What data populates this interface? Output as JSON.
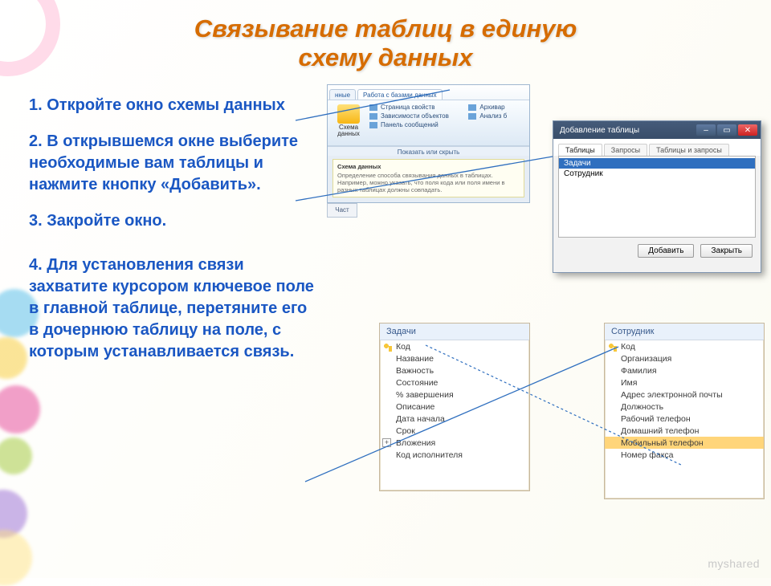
{
  "title_line1": "Связывание таблиц в единую",
  "title_line2": "схему данных",
  "steps": {
    "s1": "1. Откройте окно схемы данных",
    "s2": "2. В открывшемся окне выберите необходимые вам таблицы и нажмите кнопку «Добавить».",
    "s3": "3. Закройте окно.",
    "s4": "4. Для установления связи захватите курсором ключевое поле в главной таблице, перетяните его в дочернюю таблицу на поле, с которым устанавливается связь."
  },
  "ribbon": {
    "tab_data": "нные",
    "tab_work": "Работа с базами данных",
    "btn_schema": "Схема данных",
    "item_props": "Страница свойств",
    "item_deps": "Зависимости объектов",
    "item_msgs": "Панель сообщений",
    "item_arch": "Архивар",
    "item_anal": "Анализ б",
    "group_caption": "Показать или скрыть",
    "tooltip_title": "Схема данных",
    "tooltip_body": "Определение способа связывания данных в таблицах. Например, можно указать, что поля кода или поля имени в разных таблицах должны совпадать.",
    "side_chunk": "Част"
  },
  "dialog": {
    "title": "Добавление таблицы",
    "tab_tables": "Таблицы",
    "tab_queries": "Запросы",
    "tab_both": "Таблицы и запросы",
    "list_item1": "Задачи",
    "list_item2": "Сотрудник",
    "btn_add": "Добавить",
    "btn_close": "Закрыть"
  },
  "fieldbox1": {
    "title": "Задачи",
    "f_code": "Код",
    "f_name": "Название",
    "f_importance": "Важность",
    "f_state": "Состояние",
    "f_pct": "% завершения",
    "f_desc": "Описание",
    "f_start": "Дата начала",
    "f_due": "Срок",
    "f_attach": "Вложения",
    "f_exec": "Код исполнителя"
  },
  "fieldbox2": {
    "title": "Сотрудник",
    "f_code": "Код",
    "f_org": "Организация",
    "f_last": "Фамилия",
    "f_first": "Имя",
    "f_email": "Адрес электронной почты",
    "f_pos": "Должность",
    "f_wphone": "Рабочий телефон",
    "f_hphone": "Домашний телефон",
    "f_mphone": "Мобильный телефон",
    "f_fax": "Номер факса"
  },
  "watermark": "myshared"
}
